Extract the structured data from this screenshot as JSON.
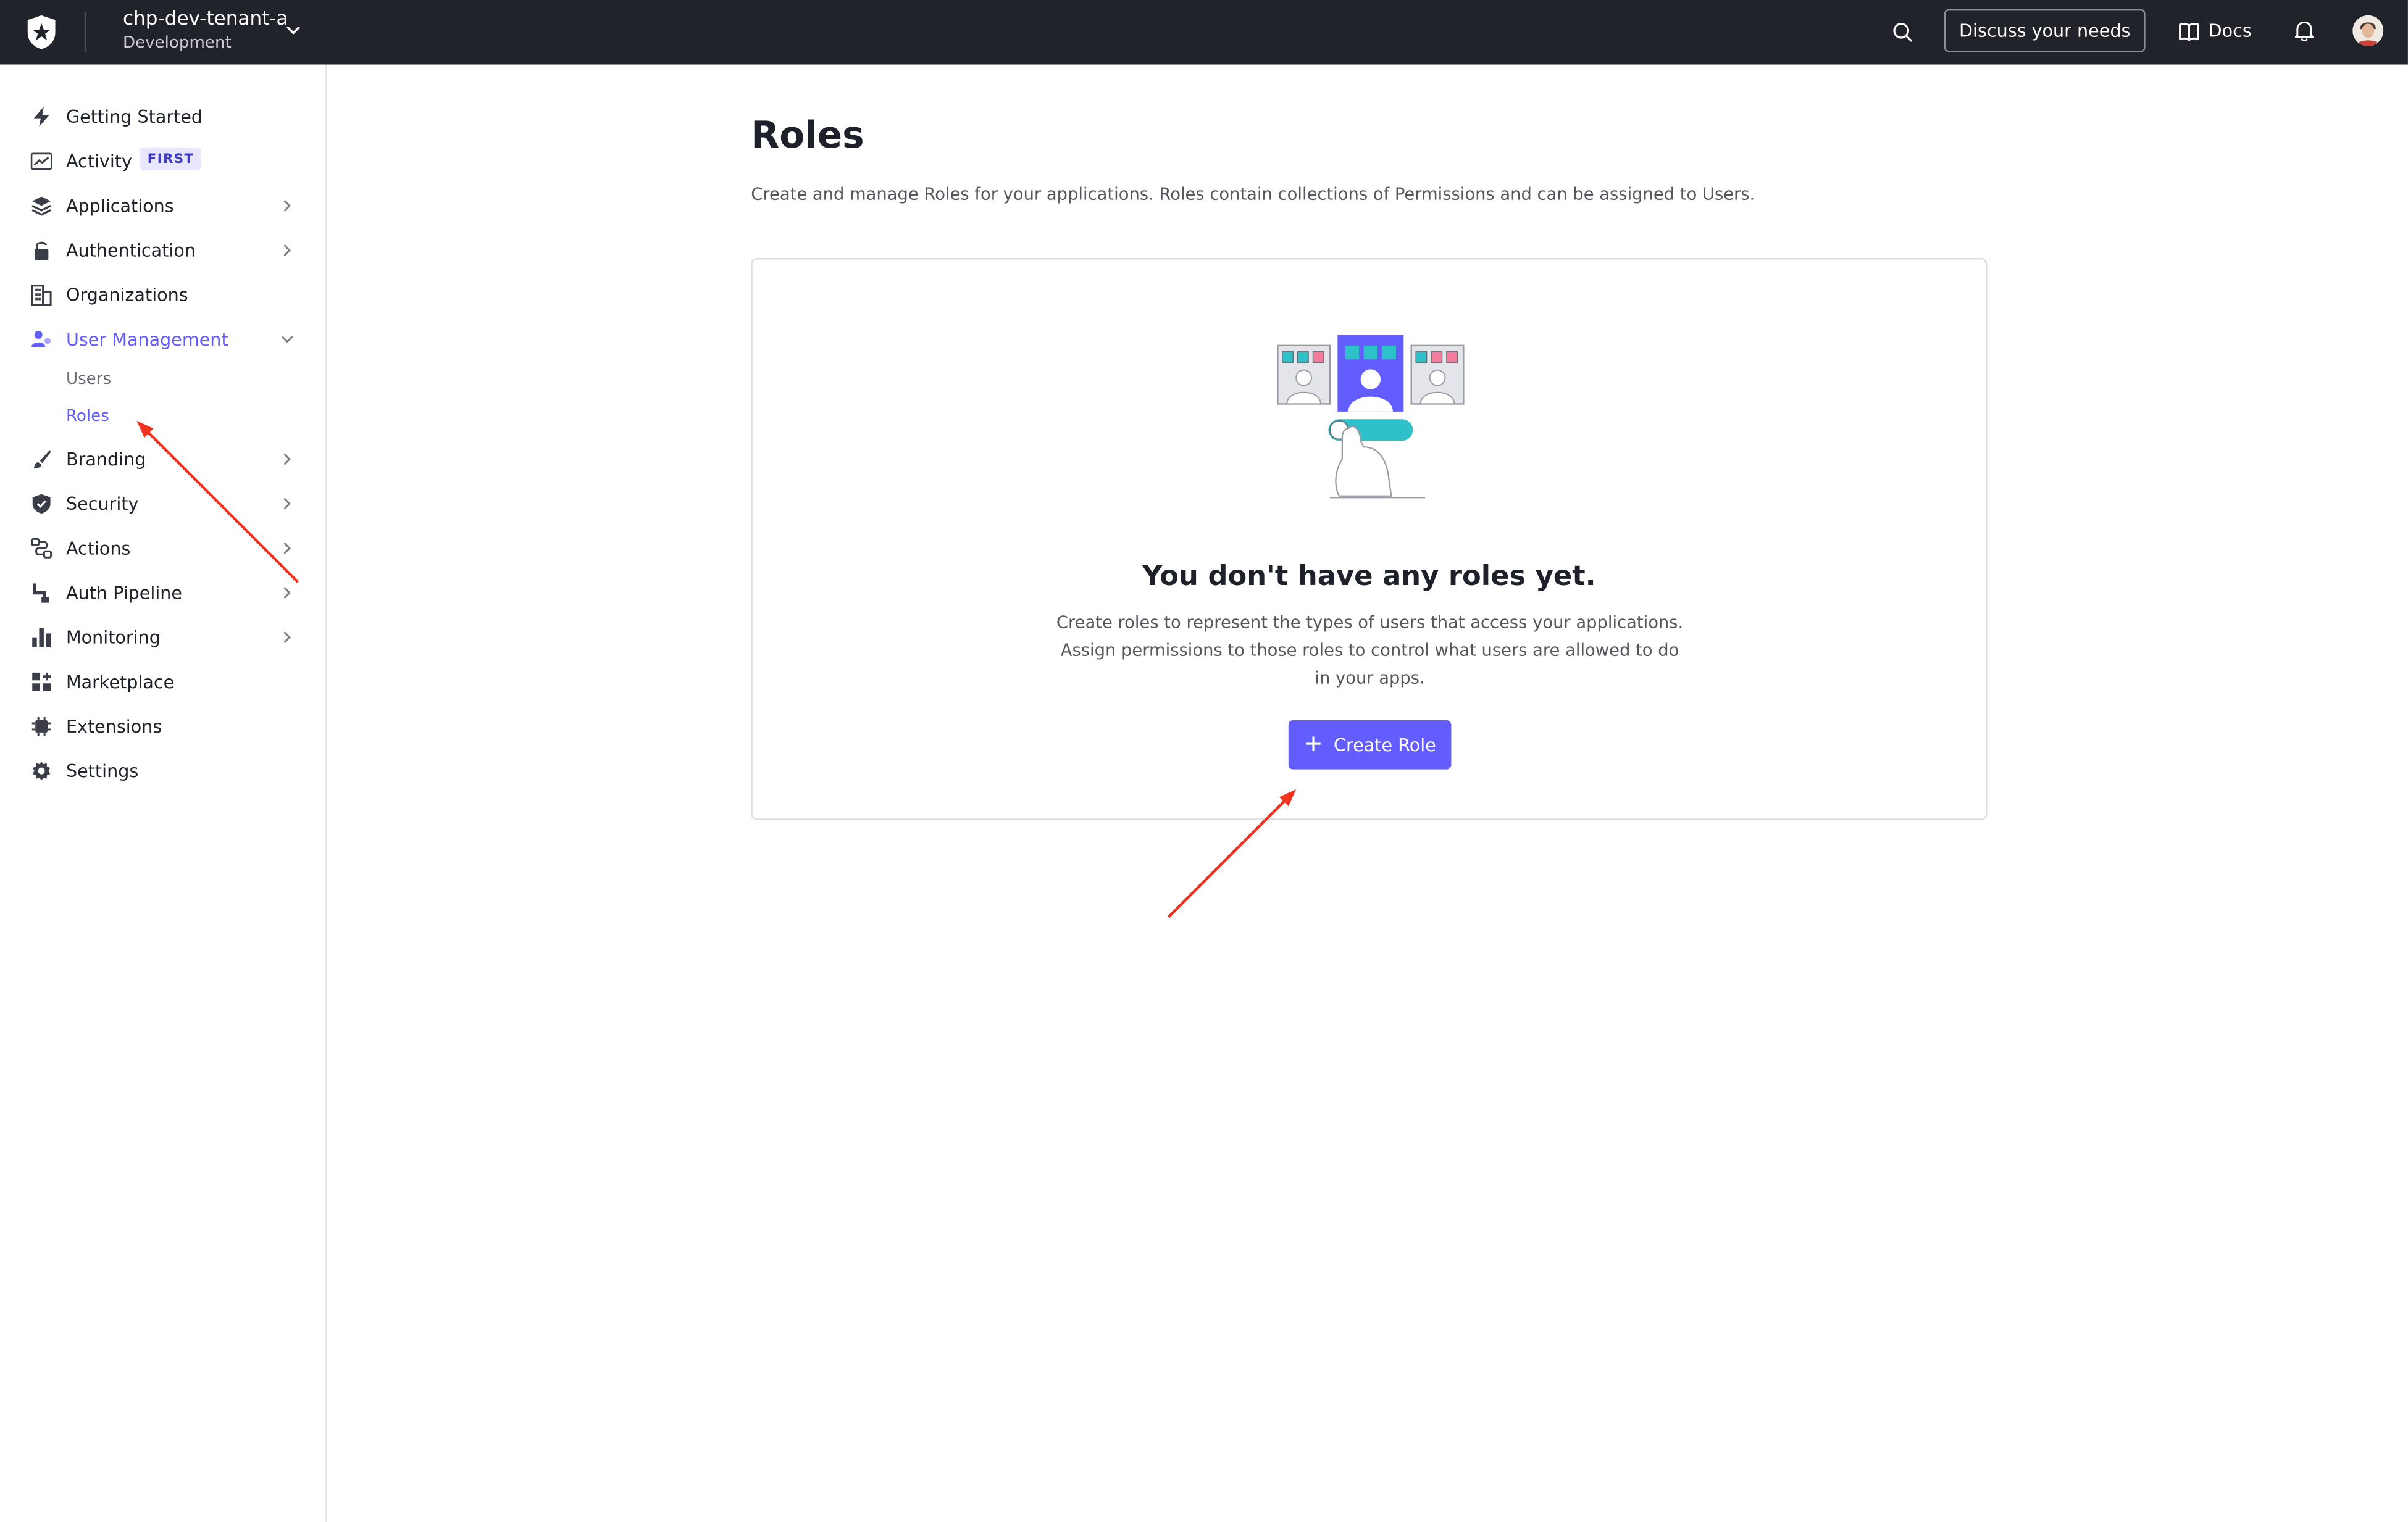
{
  "topbar": {
    "logo_icon": "auth0-shield-star-icon",
    "tenant_name": "chp-dev-tenant-a",
    "tenant_environment": "Development",
    "discuss_label": "Discuss your needs",
    "docs_label": "Docs"
  },
  "sidebar": {
    "items": [
      {
        "label": "Getting Started",
        "icon": "lightning-icon"
      },
      {
        "label": "Activity",
        "icon": "activity-chart-icon",
        "badge": "FIRST"
      },
      {
        "label": "Applications",
        "icon": "layers-icon"
      },
      {
        "label": "Authentication",
        "icon": "lock-icon"
      },
      {
        "label": "Organizations",
        "icon": "building-icon"
      },
      {
        "label": "User Management",
        "icon": "users-icon",
        "expanded": true
      },
      {
        "label": "Branding",
        "icon": "brush-icon"
      },
      {
        "label": "Security",
        "icon": "shield-icon"
      },
      {
        "label": "Actions",
        "icon": "flow-icon"
      },
      {
        "label": "Auth Pipeline",
        "icon": "pipeline-icon"
      },
      {
        "label": "Monitoring",
        "icon": "bar-chart-icon"
      },
      {
        "label": "Marketplace",
        "icon": "grid-plus-icon"
      },
      {
        "label": "Extensions",
        "icon": "chip-icon"
      },
      {
        "label": "Settings",
        "icon": "gear-icon"
      }
    ],
    "user_management_sub": {
      "users": "Users",
      "roles": "Roles"
    }
  },
  "main": {
    "title": "Roles",
    "description": "Create and manage Roles for your applications. Roles contain collections of Permissions and can be assigned to Users.",
    "empty_state": {
      "title": "You don't have any roles yet.",
      "text": "Create roles to represent the types of users that access your applications. Assign permissions to those roles to control what users are allowed to do in your apps.",
      "button_label": "Create Role"
    }
  },
  "colors": {
    "topbar_bg": "#21232b",
    "accent": "#635dff",
    "annotation_arrow": "#f0321e"
  }
}
